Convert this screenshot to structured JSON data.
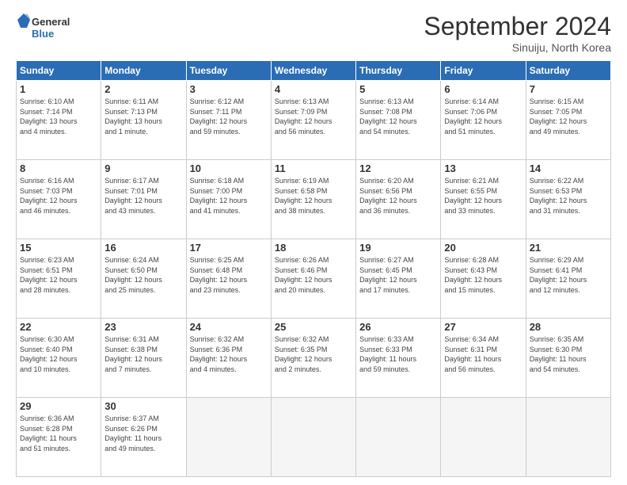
{
  "header": {
    "logo_line1": "General",
    "logo_line2": "Blue",
    "month_title": "September 2024",
    "subtitle": "Sinuiju, North Korea"
  },
  "weekdays": [
    "Sunday",
    "Monday",
    "Tuesday",
    "Wednesday",
    "Thursday",
    "Friday",
    "Saturday"
  ],
  "weeks": [
    [
      {
        "day": "1",
        "info": "Sunrise: 6:10 AM\nSunset: 7:14 PM\nDaylight: 13 hours\nand 4 minutes."
      },
      {
        "day": "2",
        "info": "Sunrise: 6:11 AM\nSunset: 7:13 PM\nDaylight: 13 hours\nand 1 minute."
      },
      {
        "day": "3",
        "info": "Sunrise: 6:12 AM\nSunset: 7:11 PM\nDaylight: 12 hours\nand 59 minutes."
      },
      {
        "day": "4",
        "info": "Sunrise: 6:13 AM\nSunset: 7:09 PM\nDaylight: 12 hours\nand 56 minutes."
      },
      {
        "day": "5",
        "info": "Sunrise: 6:13 AM\nSunset: 7:08 PM\nDaylight: 12 hours\nand 54 minutes."
      },
      {
        "day": "6",
        "info": "Sunrise: 6:14 AM\nSunset: 7:06 PM\nDaylight: 12 hours\nand 51 minutes."
      },
      {
        "day": "7",
        "info": "Sunrise: 6:15 AM\nSunset: 7:05 PM\nDaylight: 12 hours\nand 49 minutes."
      }
    ],
    [
      {
        "day": "8",
        "info": "Sunrise: 6:16 AM\nSunset: 7:03 PM\nDaylight: 12 hours\nand 46 minutes."
      },
      {
        "day": "9",
        "info": "Sunrise: 6:17 AM\nSunset: 7:01 PM\nDaylight: 12 hours\nand 43 minutes."
      },
      {
        "day": "10",
        "info": "Sunrise: 6:18 AM\nSunset: 7:00 PM\nDaylight: 12 hours\nand 41 minutes."
      },
      {
        "day": "11",
        "info": "Sunrise: 6:19 AM\nSunset: 6:58 PM\nDaylight: 12 hours\nand 38 minutes."
      },
      {
        "day": "12",
        "info": "Sunrise: 6:20 AM\nSunset: 6:56 PM\nDaylight: 12 hours\nand 36 minutes."
      },
      {
        "day": "13",
        "info": "Sunrise: 6:21 AM\nSunset: 6:55 PM\nDaylight: 12 hours\nand 33 minutes."
      },
      {
        "day": "14",
        "info": "Sunrise: 6:22 AM\nSunset: 6:53 PM\nDaylight: 12 hours\nand 31 minutes."
      }
    ],
    [
      {
        "day": "15",
        "info": "Sunrise: 6:23 AM\nSunset: 6:51 PM\nDaylight: 12 hours\nand 28 minutes."
      },
      {
        "day": "16",
        "info": "Sunrise: 6:24 AM\nSunset: 6:50 PM\nDaylight: 12 hours\nand 25 minutes."
      },
      {
        "day": "17",
        "info": "Sunrise: 6:25 AM\nSunset: 6:48 PM\nDaylight: 12 hours\nand 23 minutes."
      },
      {
        "day": "18",
        "info": "Sunrise: 6:26 AM\nSunset: 6:46 PM\nDaylight: 12 hours\nand 20 minutes."
      },
      {
        "day": "19",
        "info": "Sunrise: 6:27 AM\nSunset: 6:45 PM\nDaylight: 12 hours\nand 17 minutes."
      },
      {
        "day": "20",
        "info": "Sunrise: 6:28 AM\nSunset: 6:43 PM\nDaylight: 12 hours\nand 15 minutes."
      },
      {
        "day": "21",
        "info": "Sunrise: 6:29 AM\nSunset: 6:41 PM\nDaylight: 12 hours\nand 12 minutes."
      }
    ],
    [
      {
        "day": "22",
        "info": "Sunrise: 6:30 AM\nSunset: 6:40 PM\nDaylight: 12 hours\nand 10 minutes."
      },
      {
        "day": "23",
        "info": "Sunrise: 6:31 AM\nSunset: 6:38 PM\nDaylight: 12 hours\nand 7 minutes."
      },
      {
        "day": "24",
        "info": "Sunrise: 6:32 AM\nSunset: 6:36 PM\nDaylight: 12 hours\nand 4 minutes."
      },
      {
        "day": "25",
        "info": "Sunrise: 6:32 AM\nSunset: 6:35 PM\nDaylight: 12 hours\nand 2 minutes."
      },
      {
        "day": "26",
        "info": "Sunrise: 6:33 AM\nSunset: 6:33 PM\nDaylight: 11 hours\nand 59 minutes."
      },
      {
        "day": "27",
        "info": "Sunrise: 6:34 AM\nSunset: 6:31 PM\nDaylight: 11 hours\nand 56 minutes."
      },
      {
        "day": "28",
        "info": "Sunrise: 6:35 AM\nSunset: 6:30 PM\nDaylight: 11 hours\nand 54 minutes."
      }
    ],
    [
      {
        "day": "29",
        "info": "Sunrise: 6:36 AM\nSunset: 6:28 PM\nDaylight: 11 hours\nand 51 minutes."
      },
      {
        "day": "30",
        "info": "Sunrise: 6:37 AM\nSunset: 6:26 PM\nDaylight: 11 hours\nand 49 minutes."
      },
      {
        "day": "",
        "info": ""
      },
      {
        "day": "",
        "info": ""
      },
      {
        "day": "",
        "info": ""
      },
      {
        "day": "",
        "info": ""
      },
      {
        "day": "",
        "info": ""
      }
    ]
  ]
}
